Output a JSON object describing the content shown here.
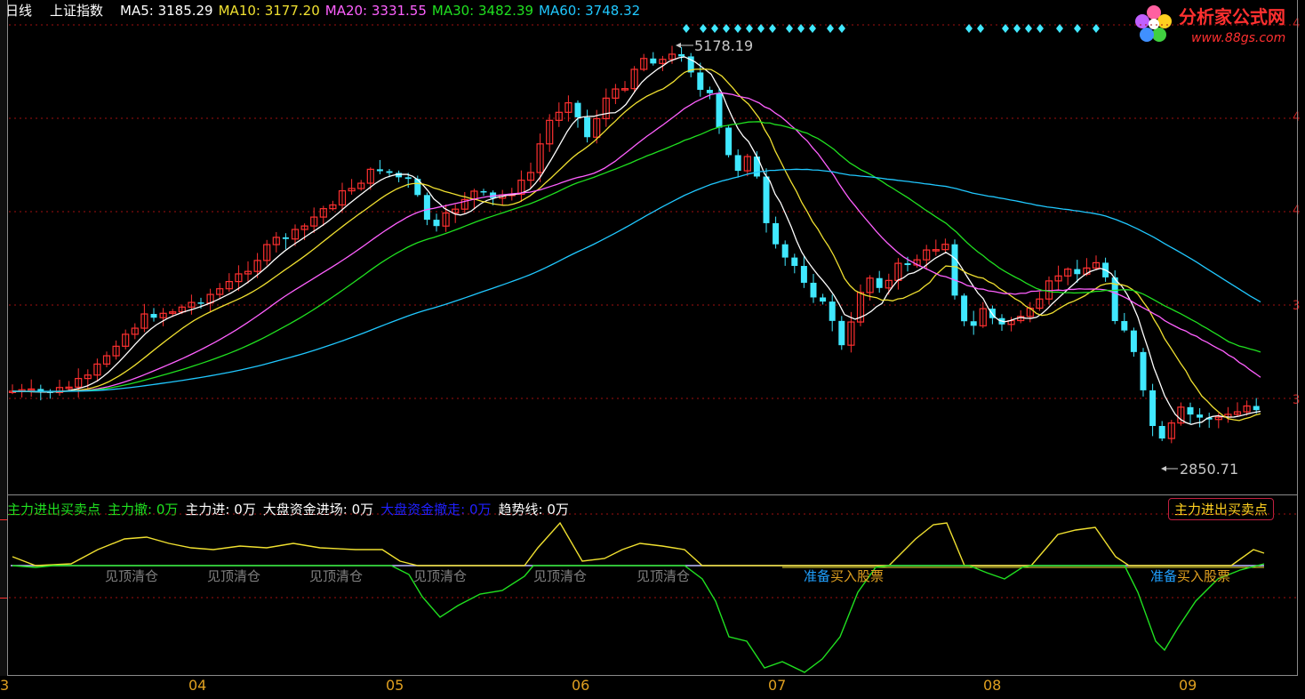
{
  "header": {
    "period": "日线",
    "symbol": "上证指数",
    "ma": [
      {
        "label": "MA5: ",
        "value": "3185.29",
        "color": "#ffffff"
      },
      {
        "label": "MA10: ",
        "value": "3177.20",
        "color": "#f0e030"
      },
      {
        "label": "MA20: ",
        "value": "3331.55",
        "color": "#ff60ff"
      },
      {
        "label": "MA30: ",
        "value": "3482.39",
        "color": "#20e020"
      },
      {
        "label": "MA60: ",
        "value": "3748.32",
        "color": "#20c8ff"
      }
    ]
  },
  "logo": {
    "title": "分析家公式网",
    "url": "www.88gs.com"
  },
  "annotations": {
    "high": "5178.19",
    "low": "2850.71"
  },
  "indicator": {
    "name": "主力进出买卖点",
    "items": [
      {
        "label": "主力撤: ",
        "value": "0万",
        "color": "#20e020"
      },
      {
        "label": "主力进: ",
        "value": "0万",
        "color": "#ffffff"
      },
      {
        "label": "大盘资金进场: ",
        "value": "0万",
        "color": "#ffffff"
      },
      {
        "label": "大盘资金撤走: ",
        "value": "0万",
        "color": "#2020ff"
      },
      {
        "label": "趋势线: ",
        "value": "0万",
        "color": "#ffffff"
      }
    ],
    "button_label": "主力进出买卖点",
    "signals_sell": [
      "见顶清仓",
      "见顶清仓",
      "见顶清仓",
      "见顶清仓",
      "见顶清仓",
      "见顶清仓"
    ],
    "signals_buy": [
      {
        "a": "准备",
        "b": "买入股票"
      },
      {
        "a": "准备",
        "b": "买入股票"
      }
    ]
  },
  "x_axis": [
    "3",
    "04",
    "05",
    "06",
    "07",
    "08",
    "09"
  ],
  "y_axis_right": [
    "4",
    "4",
    "4",
    "3",
    "3"
  ],
  "colors": {
    "up": "#ff3030",
    "down": "#40e8ff",
    "ma5": "#ffffff",
    "ma10": "#f0e030",
    "ma20": "#ff60ff",
    "ma30": "#20e020",
    "ma60": "#20c8ff",
    "grid": "#a01010",
    "diamond": "#40e8ff"
  },
  "chart_data": {
    "type": "line",
    "note_series": [
      {
        "name": "MA5"
      },
      {
        "name": "MA10"
      },
      {
        "name": "MA20"
      },
      {
        "name": "MA30"
      },
      {
        "name": "MA60"
      }
    ],
    "x": [
      "03",
      "04",
      "05",
      "06",
      "07",
      "08",
      "09"
    ],
    "annotations": {
      "max": 5178.19,
      "min": 2850.71
    }
  }
}
